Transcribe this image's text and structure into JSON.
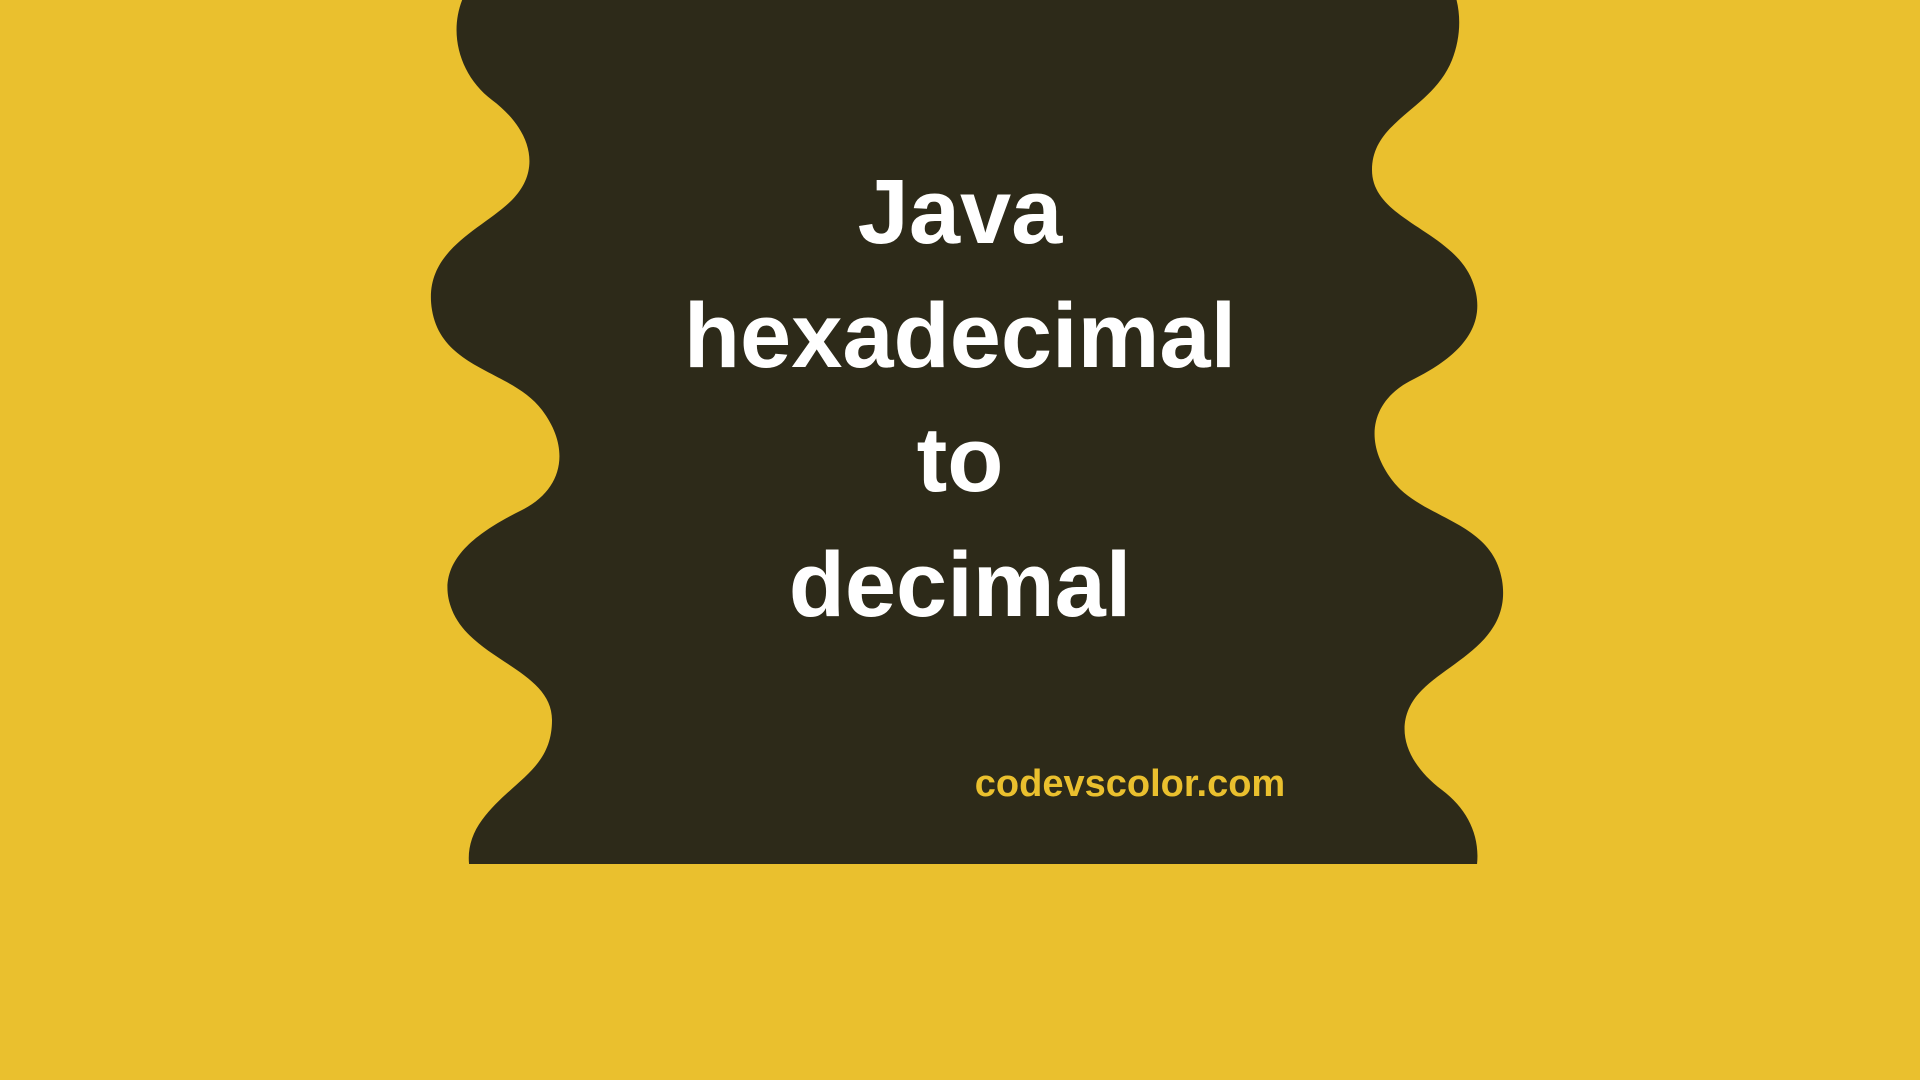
{
  "colors": {
    "bg_yellow": "#eac02e",
    "blob_dark": "#2d2a19",
    "text_white": "#ffffff"
  },
  "title": {
    "line1": "Java",
    "line2": "hexadecimal",
    "line3": "to",
    "line4": "decimal"
  },
  "website": "codevscolor.com"
}
